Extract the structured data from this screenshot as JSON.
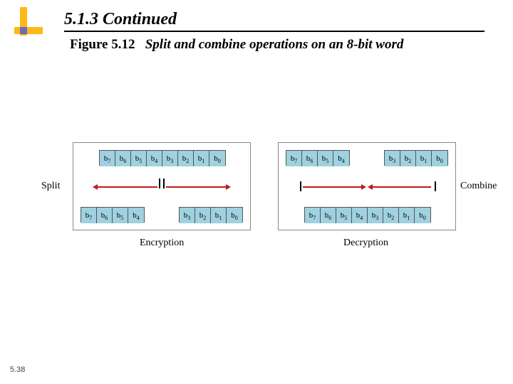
{
  "heading": "5.1.3  Continued",
  "figure": {
    "num": "Figure 5.12",
    "caption": "Split and combine operations on an 8-bit word"
  },
  "footer": "5.38",
  "labels": {
    "split": "Split",
    "combine": "Combine",
    "encryption": "Encryption",
    "decryption": "Decryption"
  },
  "bits_full": [
    "b7",
    "b6",
    "b5",
    "b4",
    "b3",
    "b2",
    "b1",
    "b0"
  ],
  "bits_left": [
    "b7",
    "b6",
    "b5",
    "b4"
  ],
  "bits_right": [
    "b3",
    "b2",
    "b1",
    "b0"
  ]
}
